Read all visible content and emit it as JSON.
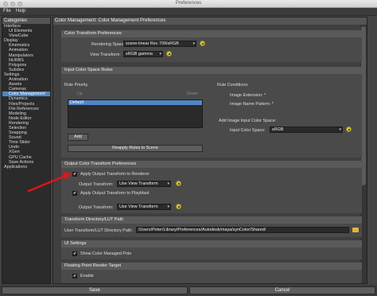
{
  "window": {
    "title": "Preferences"
  },
  "menu": {
    "file": "File",
    "help": "Help"
  },
  "sidebar": {
    "header": "Categories",
    "items": [
      {
        "label": "Interface",
        "level": 0
      },
      {
        "label": "UI Elements",
        "level": 1
      },
      {
        "label": "ViewCube",
        "level": 1
      },
      {
        "label": "Display",
        "level": 0
      },
      {
        "label": "Kinematics",
        "level": 1
      },
      {
        "label": "Animation",
        "level": 1
      },
      {
        "label": "Manipulators",
        "level": 1
      },
      {
        "label": "NURBS",
        "level": 1
      },
      {
        "label": "Polygons",
        "level": 1
      },
      {
        "label": "Subdivs",
        "level": 1
      },
      {
        "label": "Settings",
        "level": 0
      },
      {
        "label": "Animation",
        "level": 1
      },
      {
        "label": "Assets",
        "level": 1
      },
      {
        "label": "Cameras",
        "level": 1
      },
      {
        "label": "Color Management",
        "level": 1,
        "selected": true
      },
      {
        "label": "Dynamics",
        "level": 1
      },
      {
        "label": "Files/Projects",
        "level": 1
      },
      {
        "label": "File References",
        "level": 1
      },
      {
        "label": "Modeling",
        "level": 1
      },
      {
        "label": "Node Editor",
        "level": 1
      },
      {
        "label": "Rendering",
        "level": 1
      },
      {
        "label": "Selection",
        "level": 1
      },
      {
        "label": "Snapping",
        "level": 1
      },
      {
        "label": "Sound",
        "level": 1
      },
      {
        "label": "Time Slider",
        "level": 1
      },
      {
        "label": "Undo",
        "level": 1
      },
      {
        "label": "XGen",
        "level": 1
      },
      {
        "label": "GPU Cache",
        "level": 1
      },
      {
        "label": "Save Actions",
        "level": 1
      },
      {
        "label": "Applications",
        "level": 0
      }
    ]
  },
  "main": {
    "header": "Color Management: Color Management Preferences",
    "color_transform": {
      "title": "Color Transform Preferences",
      "rendering_space_label": "Rendering Space:",
      "rendering_space_value": "scene-linear Rec 709/sRGB",
      "view_transform_label": "View Transform:",
      "view_transform_value": "sRGB gamma"
    },
    "input_rules": {
      "title": "Input Color Space Rules",
      "rule_priority": "Rule Priority",
      "up": "Up",
      "down": "Down",
      "default_rule": "Default",
      "add": "Add",
      "reapply": "Reapply Rules to Scene",
      "rule_conditions": "Rule Conditions:",
      "image_extension": "Image Extension: *",
      "image_name_pattern": "Image Name Pattern: *",
      "add_image_input": "Add Image Input Color Space:",
      "input_color_space_label": "Input Color Space:",
      "input_color_space_value": "sRGB"
    },
    "output_transform": {
      "title": "Output Color Transform Preferences",
      "apply_renderer": "Apply Output Transform to Renderer",
      "output_transform_label": "Output Transform:",
      "output_transform_value": "Use View Transform",
      "apply_playblast": "Apply Output Transform to Playblast",
      "output_transform_label2": "Output Transform:",
      "output_transform_value2": "Use View Transform"
    },
    "lut_path": {
      "title": "Transform Directory/LUT Path",
      "label": "User Transform/LUT Directory Path:",
      "value": "/Users/Peter/Library/Preferences/Autodesk/maya/synColor/Shared/"
    },
    "ui_settings": {
      "title": "UI Settings",
      "show_pots": "Show Color Managed Pots"
    },
    "floating_point": {
      "title": "Floating Point Render Target",
      "enable": "Enable"
    }
  },
  "footer": {
    "save": "Save",
    "cancel": "Cancel"
  },
  "colors": {
    "accent": "#5285c4",
    "annotation_arrow": "#e0141a",
    "gear": "#d7c84a"
  }
}
